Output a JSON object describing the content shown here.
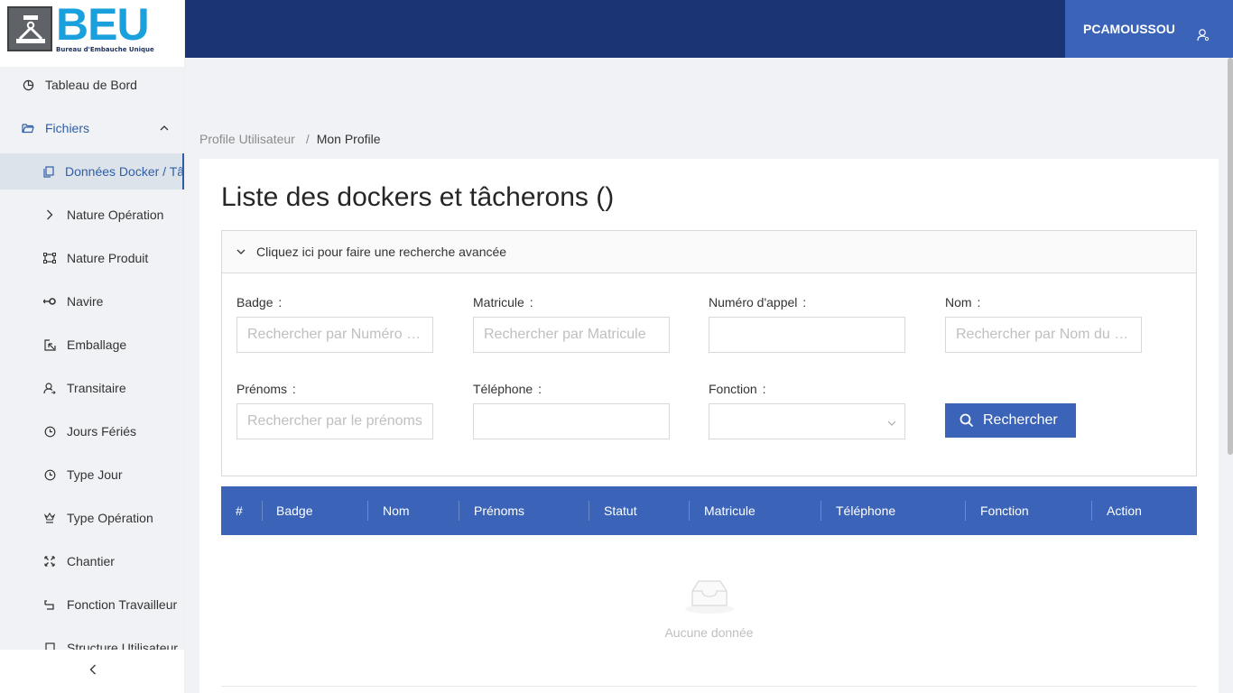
{
  "logo": {
    "text": "BEU",
    "subtitle": "Bureau d'Embauche Unique"
  },
  "header": {
    "username": "PCAMOUSSOU"
  },
  "sidebar": {
    "items": [
      {
        "label": "Tableau de Bord",
        "icon": "pie-chart-icon"
      },
      {
        "label": "Fichiers",
        "icon": "folder-open-icon"
      },
      {
        "label": "Données Docker / Tâcherons",
        "icon": "copy-icon"
      },
      {
        "label": "Nature Opération",
        "icon": "right-arrow-icon"
      },
      {
        "label": "Nature Produit",
        "icon": "border-icon"
      },
      {
        "label": "Navire",
        "icon": "swap-icon"
      },
      {
        "label": "Emballage",
        "icon": "select-icon"
      },
      {
        "label": "Transitaire",
        "icon": "user-switch-icon"
      },
      {
        "label": "Jours Fériés",
        "icon": "clock-icon"
      },
      {
        "label": "Type Jour",
        "icon": "clock-icon"
      },
      {
        "label": "Type Opération",
        "icon": "trophy-icon"
      },
      {
        "label": "Chantier",
        "icon": "expand-icon"
      },
      {
        "label": "Fonction Travailleur",
        "icon": "rollback-icon"
      },
      {
        "label": "Structure Utilisateur",
        "icon": "file-icon"
      }
    ],
    "collapse_glyph": "<"
  },
  "breadcrumb": {
    "parent": "Profile Utilisateur",
    "separator": "/",
    "current": "Mon Profile"
  },
  "page": {
    "title": "Liste des dockers et tâcherons ()"
  },
  "search": {
    "toggle_label": "Cliquez ici pour faire une recherche avancée",
    "colon": ":",
    "fields": {
      "badge": {
        "label": "Badge",
        "placeholder": "Rechercher par Numéro Badge"
      },
      "matricule": {
        "label": "Matricule",
        "placeholder": "Rechercher par Matricule"
      },
      "numero_appel": {
        "label": "Numéro d'appel",
        "placeholder": ""
      },
      "nom": {
        "label": "Nom",
        "placeholder": "Rechercher par Nom du docker"
      },
      "prenoms": {
        "label": "Prénoms",
        "placeholder": "Rechercher par le prénoms"
      },
      "telephone": {
        "label": "Téléphone",
        "placeholder": ""
      },
      "fonction": {
        "label": "Fonction",
        "selected": ""
      }
    },
    "submit_label": "Rechercher"
  },
  "table": {
    "columns": [
      "#",
      "Badge",
      "Nom",
      "Prénoms",
      "Statut",
      "Matricule",
      "Téléphone",
      "Fonction",
      "Action"
    ],
    "empty_text": "Aucune donnée"
  },
  "colors": {
    "header_bg": "#1b3574",
    "accent": "#3b64b8",
    "active_text": "#2f5ea8",
    "logo_blue": "#1aa1dd"
  }
}
